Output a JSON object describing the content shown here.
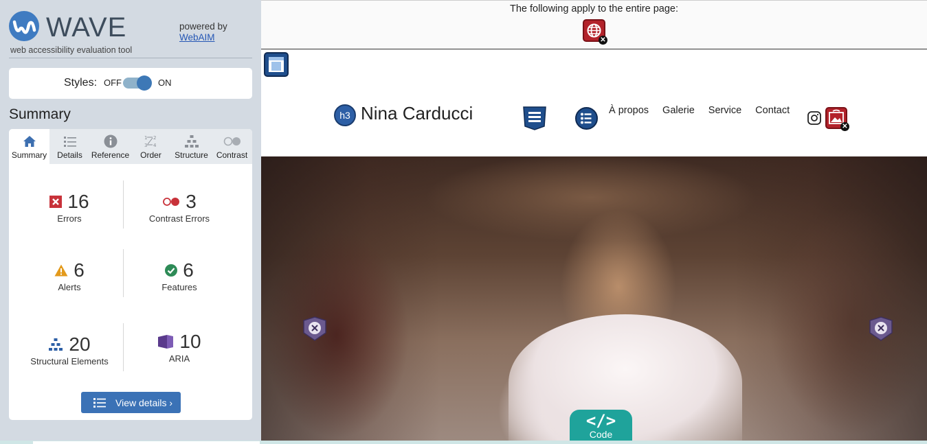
{
  "wave": {
    "logo_title": "WAVE",
    "logo_subtitle": "web accessibility evaluation tool",
    "powered_by": "powered by",
    "webaim_link": "WebAIM",
    "styles_label": "Styles:",
    "styles_off": "OFF",
    "styles_on": "ON",
    "summary_heading": "Summary",
    "tabs": [
      {
        "label": "Summary",
        "icon": "home-icon",
        "active": true
      },
      {
        "label": "Details",
        "icon": "list-icon"
      },
      {
        "label": "Reference",
        "icon": "info-icon"
      },
      {
        "label": "Order",
        "icon": "order-icon"
      },
      {
        "label": "Structure",
        "icon": "structure-icon"
      },
      {
        "label": "Contrast",
        "icon": "contrast-icon"
      }
    ],
    "stats": {
      "errors": {
        "count": "16",
        "label": "Errors",
        "color": "#c8323a"
      },
      "contrast_errors": {
        "count": "3",
        "label": "Contrast Errors",
        "color": "#c8323a"
      },
      "alerts": {
        "count": "6",
        "label": "Alerts",
        "color": "#e39a1c"
      },
      "features": {
        "count": "6",
        "label": "Features",
        "color": "#2e8b57"
      },
      "structural": {
        "count": "20",
        "label": "Structural Elements",
        "color": "#2d5fa6"
      },
      "aria": {
        "count": "10",
        "label": "ARIA",
        "color": "#5a3a8c"
      }
    },
    "view_details": "View details ›"
  },
  "page": {
    "apply_text": "The following apply to the entire page:",
    "site_title": "Nina Carducci",
    "heading_badge": "h3",
    "nav": [
      "À propos",
      "Galerie",
      "Service",
      "Contact"
    ],
    "code_button": "Code",
    "code_glyph": "</>"
  }
}
